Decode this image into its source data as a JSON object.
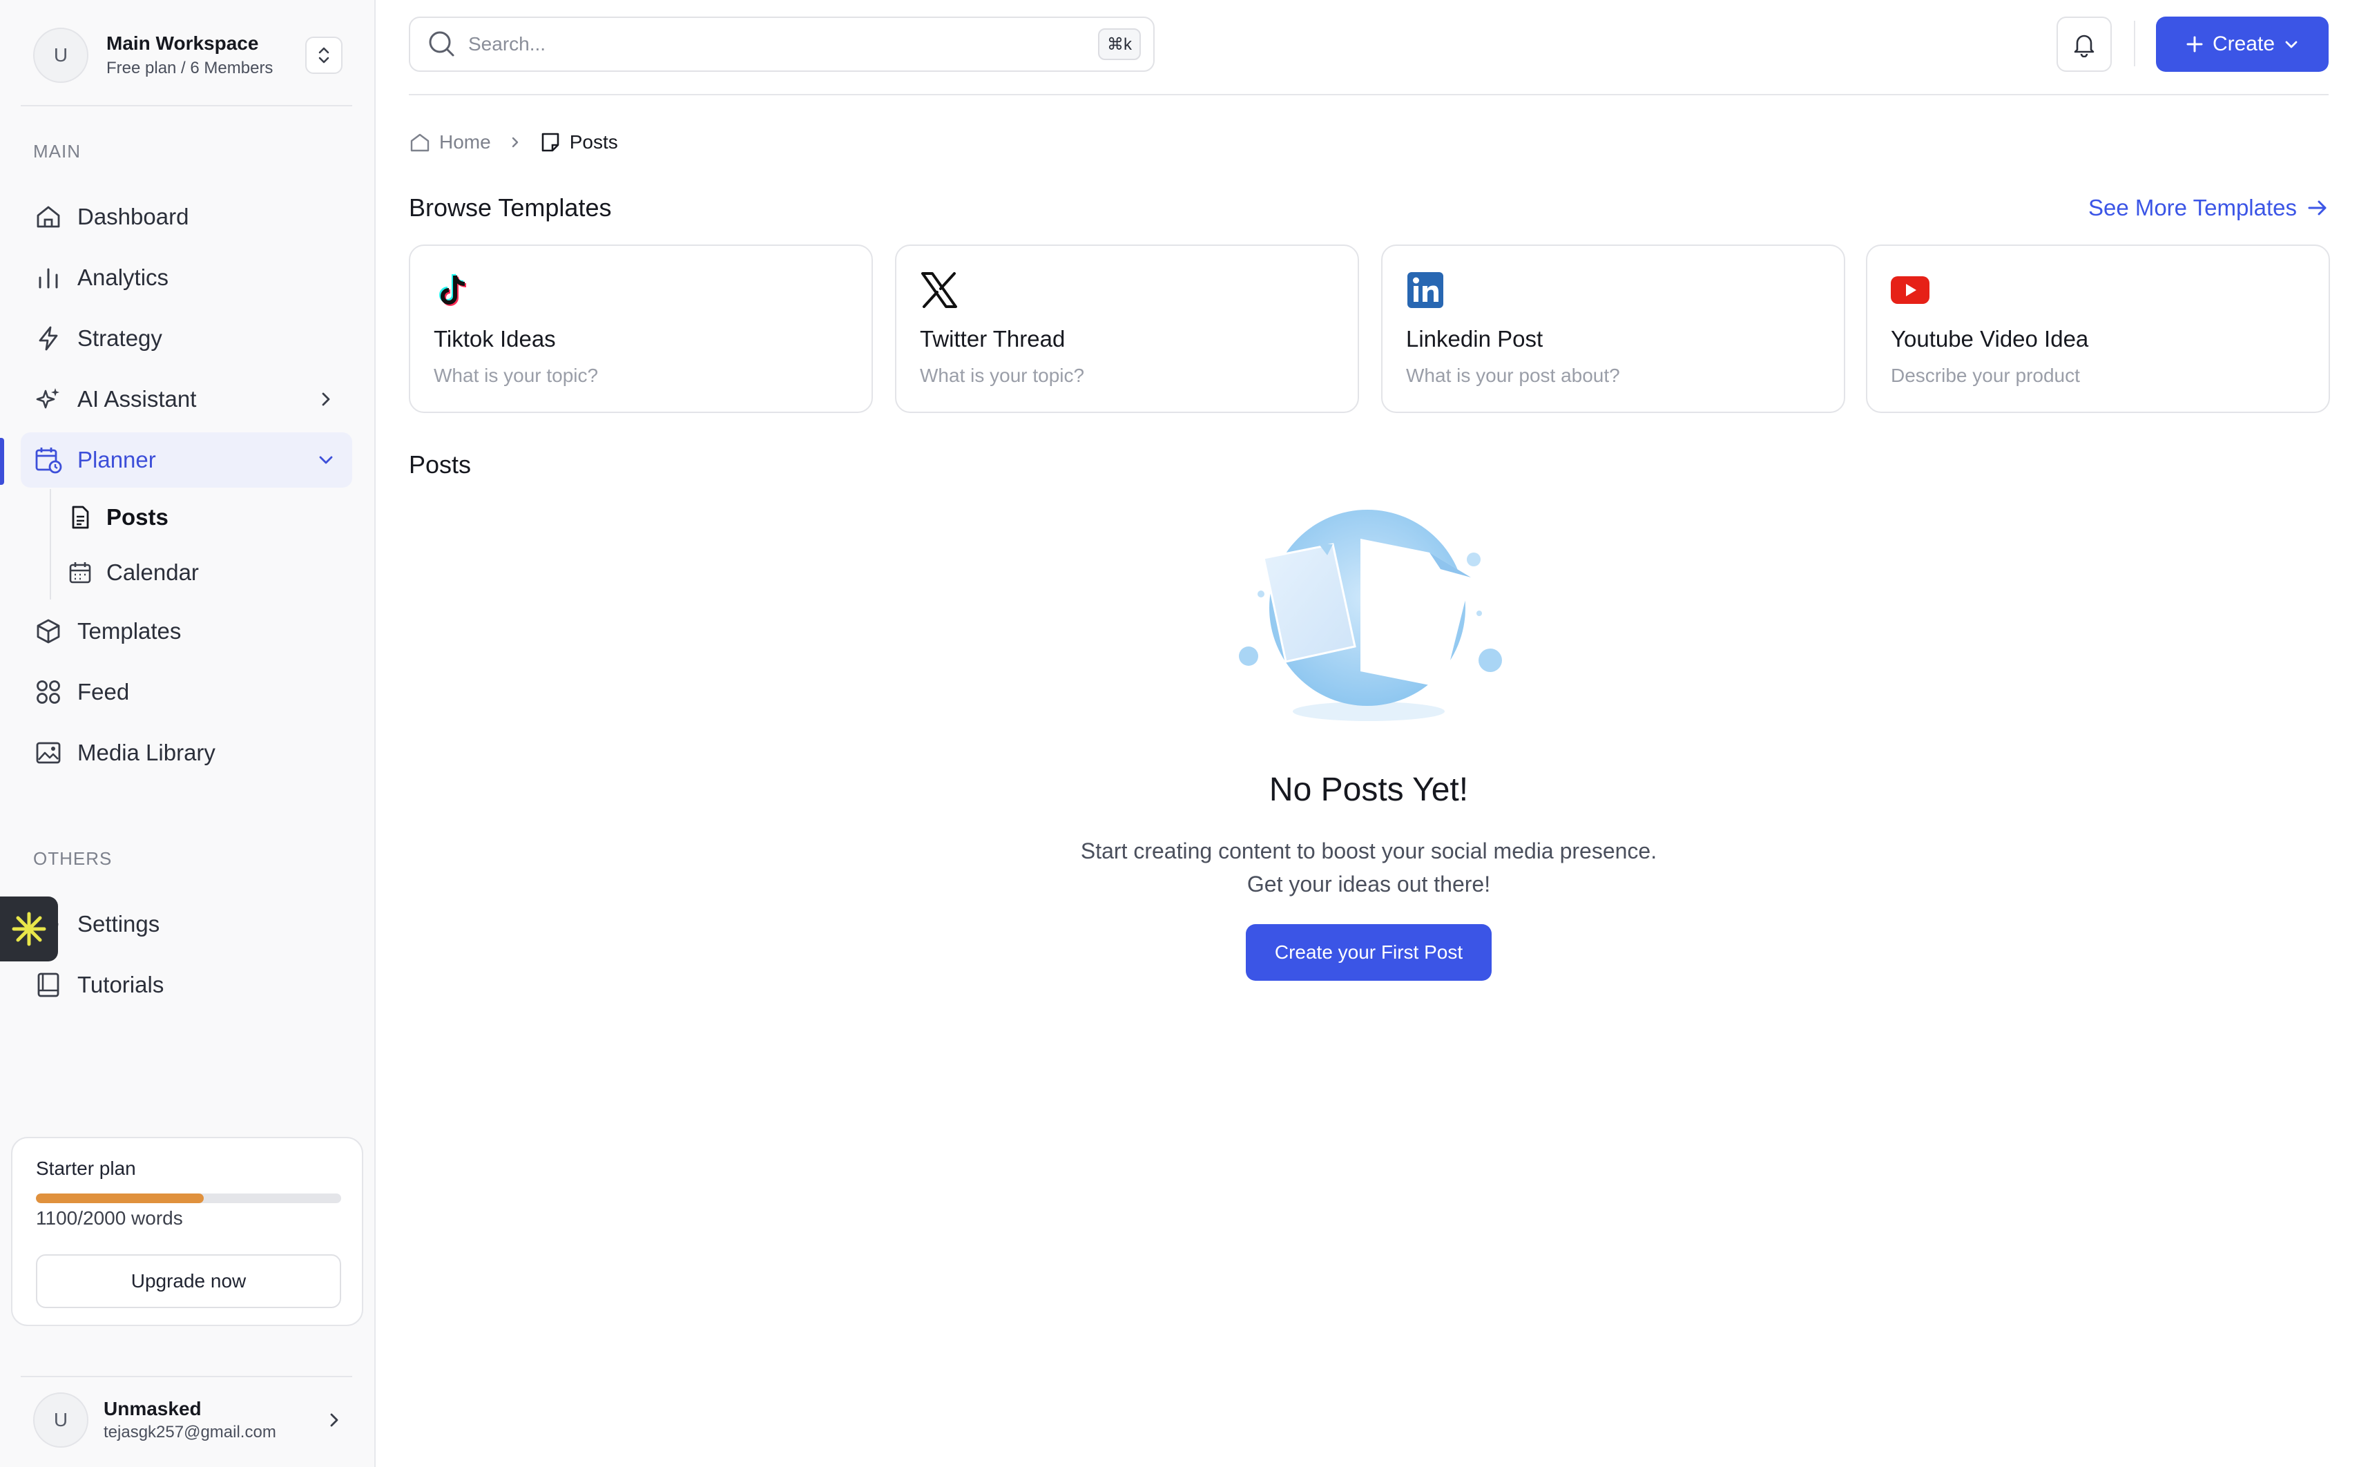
{
  "workspace": {
    "avatar": "U",
    "name": "Main Workspace",
    "plan": "Free plan / 6 Members"
  },
  "sidebar": {
    "main_label": "MAIN",
    "items": [
      {
        "label": "Dashboard",
        "icon": "home-icon"
      },
      {
        "label": "Analytics",
        "icon": "bar-chart-icon"
      },
      {
        "label": "Strategy",
        "icon": "bolt-icon"
      },
      {
        "label": "AI Assistant",
        "icon": "sparkles-icon"
      },
      {
        "label": "Planner",
        "icon": "calendar-clock-icon"
      },
      {
        "label": "Templates",
        "icon": "cube-icon"
      },
      {
        "label": "Feed",
        "icon": "grid-icon"
      },
      {
        "label": "Media Library",
        "icon": "image-icon"
      }
    ],
    "planner_sub": [
      {
        "label": "Posts",
        "icon": "document-icon"
      },
      {
        "label": "Calendar",
        "icon": "calendar-icon"
      }
    ],
    "others_label": "OTHERS",
    "others": [
      {
        "label": "Settings",
        "icon": "gear-icon"
      },
      {
        "label": "Tutorials",
        "icon": "book-icon"
      }
    ]
  },
  "plan": {
    "title": "Starter plan",
    "words": "1100/2000 words",
    "used_fraction": 0.55,
    "upgrade_label": "Upgrade now"
  },
  "user": {
    "avatar": "U",
    "name": "Unmasked",
    "email": "tejasgk257@gmail.com"
  },
  "topbar": {
    "search_placeholder": "Search...",
    "shortcut": "⌘k",
    "create_label": "Create"
  },
  "breadcrumb": {
    "home": "Home",
    "current": "Posts"
  },
  "templates": {
    "heading": "Browse Templates",
    "see_more": "See More Templates",
    "cards": [
      {
        "title": "Tiktok Ideas",
        "subtitle": "What is your topic?",
        "icon": "tiktok-icon"
      },
      {
        "title": "Twitter Thread",
        "subtitle": "What is your topic?",
        "icon": "x-icon"
      },
      {
        "title": "Linkedin Post",
        "subtitle": "What is your post about?",
        "icon": "linkedin-icon"
      },
      {
        "title": "Youtube Video Idea",
        "subtitle": "Describe your product",
        "icon": "youtube-icon"
      }
    ]
  },
  "posts": {
    "heading": "Posts",
    "empty_title": "No Posts Yet!",
    "empty_line1": "Start creating content to boost your social media presence.",
    "empty_line2": "Get your ideas out there!",
    "cta": "Create your First Post"
  },
  "colors": {
    "accent": "#3b55e6",
    "plan_fill": "#e0913d",
    "youtube": "#e62117",
    "linkedin": "#2867b2"
  }
}
